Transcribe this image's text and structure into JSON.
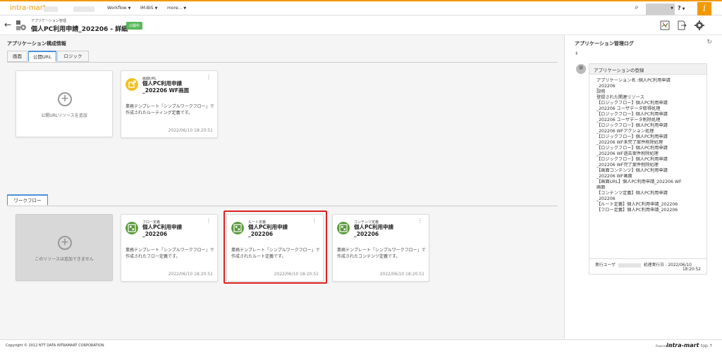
{
  "brand": "intra-mart",
  "nav": {
    "workflow": "Workflow",
    "imbis": "IM-BIS",
    "more": "more..."
  },
  "help": "?",
  "header": {
    "breadcrumb": "アプリケーション管理",
    "title": "個人PC利用申請_202206 - 詳細",
    "status": "公開中",
    "status_color": "#5cb85c"
  },
  "config": {
    "section_title": "アプリケーション構成情報",
    "tabs": [
      "画面",
      "公開URL",
      "ロジック"
    ],
    "add_label": "公開URLリソースを追加",
    "card": {
      "type": "画面URL",
      "name_line1": "個人PC利用申請",
      "name_line2": "_202206 WF画面",
      "description": "業務テンプレート「シンプルワークフロー」で作成されたルーティング定義です。",
      "date": "2022/06/10 18:20:51"
    }
  },
  "workflow": {
    "tab": "ワークフロー",
    "disabled_label": "このリソースは追加できません",
    "cards": [
      {
        "type": "フロー定義",
        "name_line1": "個人PC利用申請",
        "name_line2": "_202206",
        "description": "業務テンプレート「シンプルワークフロー」で作成されたフロー定義です。",
        "date": "2022/06/10 18:20:51"
      },
      {
        "type": "ルート定義",
        "name_line1": "個人PC利用申請",
        "name_line2": "_202206",
        "description": "業務テンプレート「シンプルワークフロー」で作成されたルート定義です。",
        "date": "2022/06/10 18:20:51"
      },
      {
        "type": "コンテンツ定義",
        "name_line1": "個人PC利用申請",
        "name_line2": "_202206",
        "description": "業務テンプレート「シンプルワークフロー」で作成されたコンテンツ定義です。",
        "date": "2022/06/10 18:20:51"
      }
    ]
  },
  "log": {
    "title": "アプリケーション管理ログ",
    "entry_title": "アプリケーションの登録",
    "lines": [
      "アプリケーション名 :個人PC利用申請",
      "_202206",
      "説明",
      "登録された関連リソース",
      "【ロジックフロー】個人PC利用申請",
      "_202206 ユーザデータ取得処理",
      "【ロジックフロー】個人PC利用申請",
      "_202206 ユーザデータ削除処理",
      "【ロジックフロー】個人PC利用申請",
      "_202206 WFアクション処理",
      "【ロジックフロー】個人PC利用申請",
      "_202206 WF未完了案件削除処理",
      "【ロジックフロー】個人PC利用申請",
      "_202206 WF過去案件削除処理",
      "【ロジックフロー】個人PC利用申請",
      "_202206 WF完了案件削除処理",
      "【画面コンテンツ】個人PC利用申請",
      "_202206 WF画面",
      "【画面URL】個人PC利用申請_202206 WF",
      "画面",
      "【コンテンツ定義】個人PC利用申請",
      "_202206",
      "【ルート定義】個人PC利用申請_202206",
      "【フロー定義】個人PC利用申請_202206"
    ],
    "executor_label": "実行ユーザ",
    "exec_date_label": "処理実行日 : 2022/06/10",
    "exec_time": "18:20:52"
  },
  "footer": {
    "copyright": "Copyright © 2012 NTT DATA INTRAMART CORPORATION",
    "powered": "Powered by",
    "powered_brand": "intra-mart",
    "top": "top ↑"
  }
}
